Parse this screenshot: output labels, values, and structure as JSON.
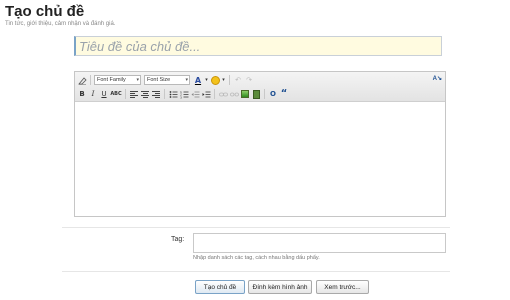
{
  "header": {
    "title": "Tạo chủ đề",
    "subtitle": "Tin tức, giới thiệu, cảm nhận và đánh giá."
  },
  "form": {
    "title_placeholder": "Tiêu đề của chủ đề...",
    "title_value": "",
    "editor": {
      "font_family_label": "Font Family",
      "font_size_label": "Font Size",
      "content": "",
      "toolbar_row1_icons": [
        "remove-format-icon",
        "font-family-select",
        "font-size-select",
        "font-color-icon",
        "smiley-icon",
        "undo-icon",
        "redo-icon",
        "text-direction-icon"
      ],
      "toolbar_row2_icons": [
        "bold-icon",
        "italic-icon",
        "underline-icon",
        "strikethrough-icon",
        "align-left-icon",
        "align-center-icon",
        "align-right-icon",
        "bullet-list-icon",
        "numbered-list-icon",
        "outdent-icon",
        "indent-icon",
        "link-icon",
        "unlink-icon",
        "image-icon",
        "media-icon",
        "code-icon",
        "quote-icon"
      ],
      "toolbar_labels": {
        "bold": "B",
        "italic": "I",
        "underline": "U",
        "strike": "ABC",
        "font_color": "A",
        "code": "O",
        "quote": "“"
      }
    },
    "tags": {
      "label": "Tag:",
      "value": "",
      "hint": "Nhập danh sách các tag, cách nhau bằng dấu phẩy."
    },
    "buttons": {
      "create": "Tạo chủ đề",
      "attach": "Đính kèm hình ảnh",
      "preview": "Xem trước..."
    }
  },
  "colors": {
    "title_input_bg": "#fffbe0",
    "title_input_accent": "#7aa3c7",
    "toolbar_bg": "#e9e9e9",
    "link_blue": "#1d4f91"
  }
}
